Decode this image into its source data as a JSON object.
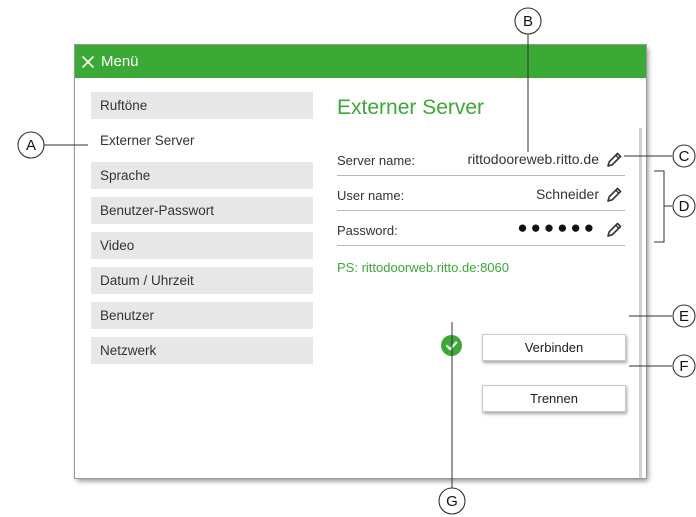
{
  "window": {
    "title": "Menü",
    "close_icon": "close-icon"
  },
  "menu": {
    "items": [
      {
        "label": "Ruftöne",
        "active": false
      },
      {
        "label": "Externer Server",
        "active": true
      },
      {
        "label": "Sprache",
        "active": false
      },
      {
        "label": "Benutzer-Passwort",
        "active": false
      },
      {
        "label": "Video",
        "active": false
      },
      {
        "label": "Datum / Uhrzeit",
        "active": false
      },
      {
        "label": "Benutzer",
        "active": false
      },
      {
        "label": "Netzwerk",
        "active": false
      }
    ]
  },
  "server_panel": {
    "title": "Externer Server",
    "fields": [
      {
        "label": "Server name:",
        "value": "rittodooreweb.ritto.de",
        "edit_icon": "pencil-icon"
      },
      {
        "label": "User name:",
        "value": "Schneider",
        "edit_icon": "pencil-icon"
      },
      {
        "label": "Password:",
        "value": "●●●●●●",
        "edit_icon": "pencil-icon"
      }
    ],
    "ps_info": "PS: rittodoorweb.ritto.de:8060",
    "status_icon": "check-circle-icon",
    "connect_label": "Verbinden",
    "disconnect_label": "Trennen"
  },
  "callouts": {
    "labels": [
      "A",
      "B",
      "C",
      "D",
      "E",
      "F",
      "G"
    ]
  },
  "colors": {
    "accent": "#3aa935",
    "menu_item_bg": "#e7e7e7",
    "window_bg": "#eeeeee"
  }
}
